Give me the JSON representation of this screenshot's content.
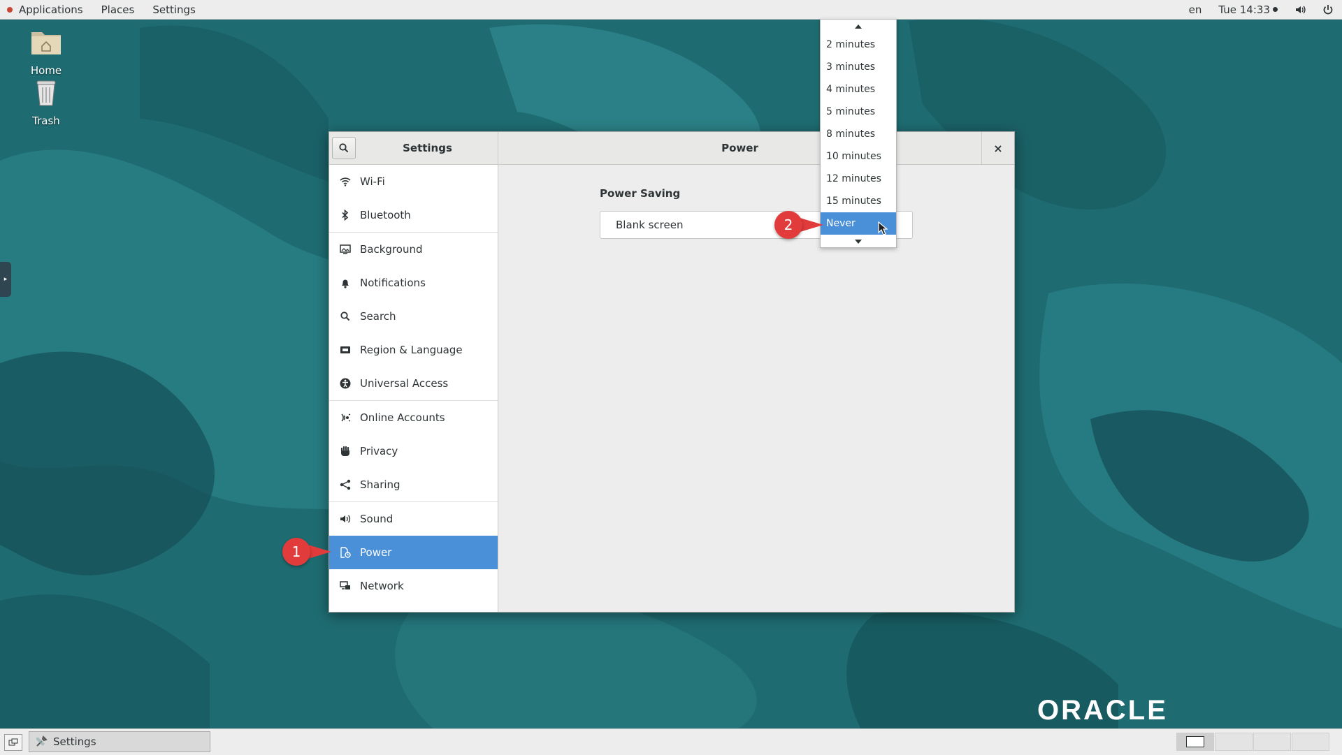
{
  "topbar": {
    "applications": "Applications",
    "places": "Places",
    "settings": "Settings",
    "language": "en",
    "clock": "Tue 14:33"
  },
  "desktop": {
    "icons": [
      {
        "label": "Home",
        "icon": "home-folder-icon"
      },
      {
        "label": "Trash",
        "icon": "trash-icon"
      }
    ],
    "branding": "ORACLE"
  },
  "window": {
    "sidebar_title": "Settings",
    "panel_title": "Power",
    "close": "×",
    "sidebar_items": [
      {
        "label": "Wi-Fi",
        "icon": "wifi-icon"
      },
      {
        "label": "Bluetooth",
        "icon": "bluetooth-icon"
      },
      {
        "label": "Background",
        "icon": "background-icon"
      },
      {
        "label": "Notifications",
        "icon": "bell-icon"
      },
      {
        "label": "Search",
        "icon": "search-icon"
      },
      {
        "label": "Region & Language",
        "icon": "flag-icon"
      },
      {
        "label": "Universal Access",
        "icon": "accessibility-icon"
      },
      {
        "label": "Online Accounts",
        "icon": "online-accounts-icon"
      },
      {
        "label": "Privacy",
        "icon": "hand-icon"
      },
      {
        "label": "Sharing",
        "icon": "share-icon"
      },
      {
        "label": "Sound",
        "icon": "speaker-icon"
      },
      {
        "label": "Power",
        "icon": "power-icon",
        "active": true
      },
      {
        "label": "Network",
        "icon": "network-icon"
      }
    ],
    "content": {
      "section_title": "Power Saving",
      "blank_screen_label": "Blank screen"
    }
  },
  "dropdown": {
    "options": [
      "2 minutes",
      "3 minutes",
      "4 minutes",
      "5 minutes",
      "8 minutes",
      "10 minutes",
      "12 minutes",
      "15 minutes",
      "Never"
    ],
    "selected": "Never"
  },
  "callouts": [
    "1",
    "2"
  ],
  "taskbar": {
    "window_button": "Settings"
  },
  "colors": {
    "accent": "#4a90d9",
    "callout": "#e23b3b",
    "desktop": "#1f6e73"
  }
}
